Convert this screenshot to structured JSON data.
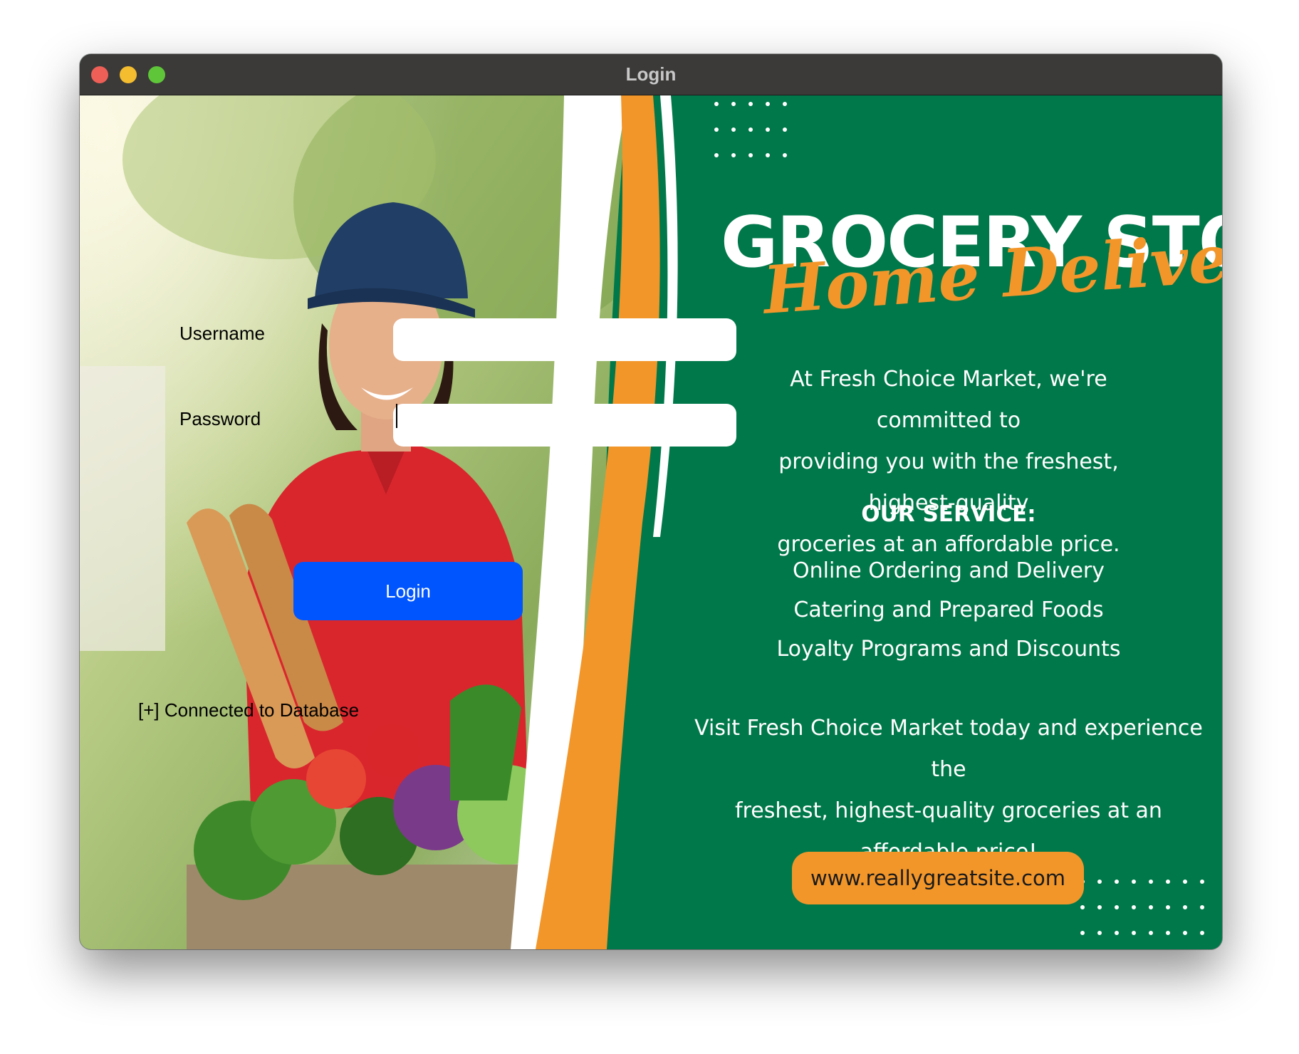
{
  "window": {
    "title": "Login"
  },
  "form": {
    "username_label": "Username",
    "username_value": "",
    "password_label": "Password",
    "password_value": "",
    "login_label": "Login",
    "status": "[+] Connected to Database"
  },
  "banner": {
    "title": "GROCERY STORE",
    "subtitle": "Home Delivery",
    "intro_lines": [
      "At Fresh Choice Market, we're committed to",
      "providing you with the freshest, highest-quality",
      "groceries at an affordable price."
    ],
    "service_title": "OUR SERVICE:",
    "services": [
      "Online Ordering and Delivery",
      "Catering and Prepared Foods",
      "Loyalty Programs and Discounts"
    ],
    "outro_lines": [
      "Visit Fresh Choice Market today and experience the",
      "freshest, highest-quality groceries at an affordable price!"
    ],
    "website": "www.reallygreatsite.com"
  },
  "colors": {
    "green": "#00784a",
    "orange": "#f2962a",
    "login_button": "#0055ff",
    "titlebar": "#3b3a38"
  }
}
